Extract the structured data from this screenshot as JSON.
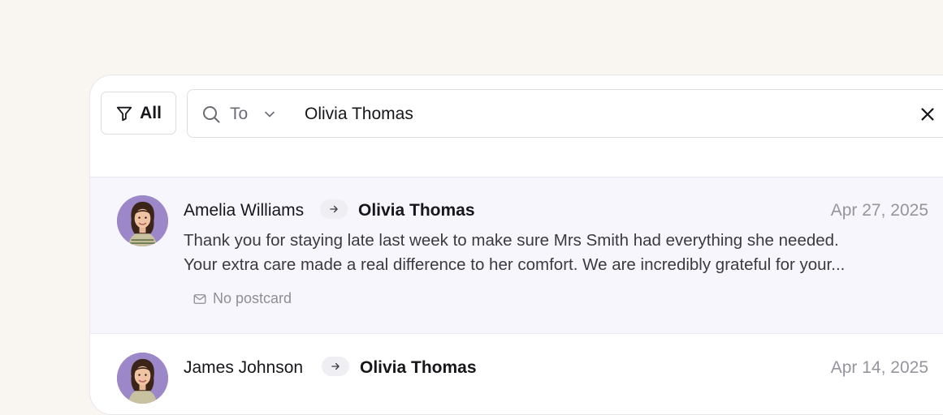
{
  "toolbar": {
    "filter_label": "All",
    "search_scope": "To",
    "search_value": "Olivia Thomas"
  },
  "messages": [
    {
      "sender": "Amelia Williams",
      "recipient": "Olivia Thomas",
      "date": "Apr 27, 2025",
      "body_lines": [
        "Thank you for staying late last week to make sure Mrs Smith had everything she needed.",
        "Your extra care made a real difference to her comfort. We are incredibly grateful for your..."
      ],
      "postcard_status": "No postcard"
    },
    {
      "sender": "James Johnson",
      "recipient": "Olivia Thomas",
      "date": "Apr 14, 2025"
    }
  ],
  "icons": {
    "filter": "filter-icon",
    "search": "search-icon",
    "dropdown": "chevron-down-icon",
    "clear": "close-icon",
    "arrow": "arrow-right-icon",
    "postcard": "mail-icon"
  },
  "colors": {
    "page_background": "#f9f5f1",
    "selected_row": "#f7f6fc",
    "avatar_background": "#9c87c9"
  }
}
